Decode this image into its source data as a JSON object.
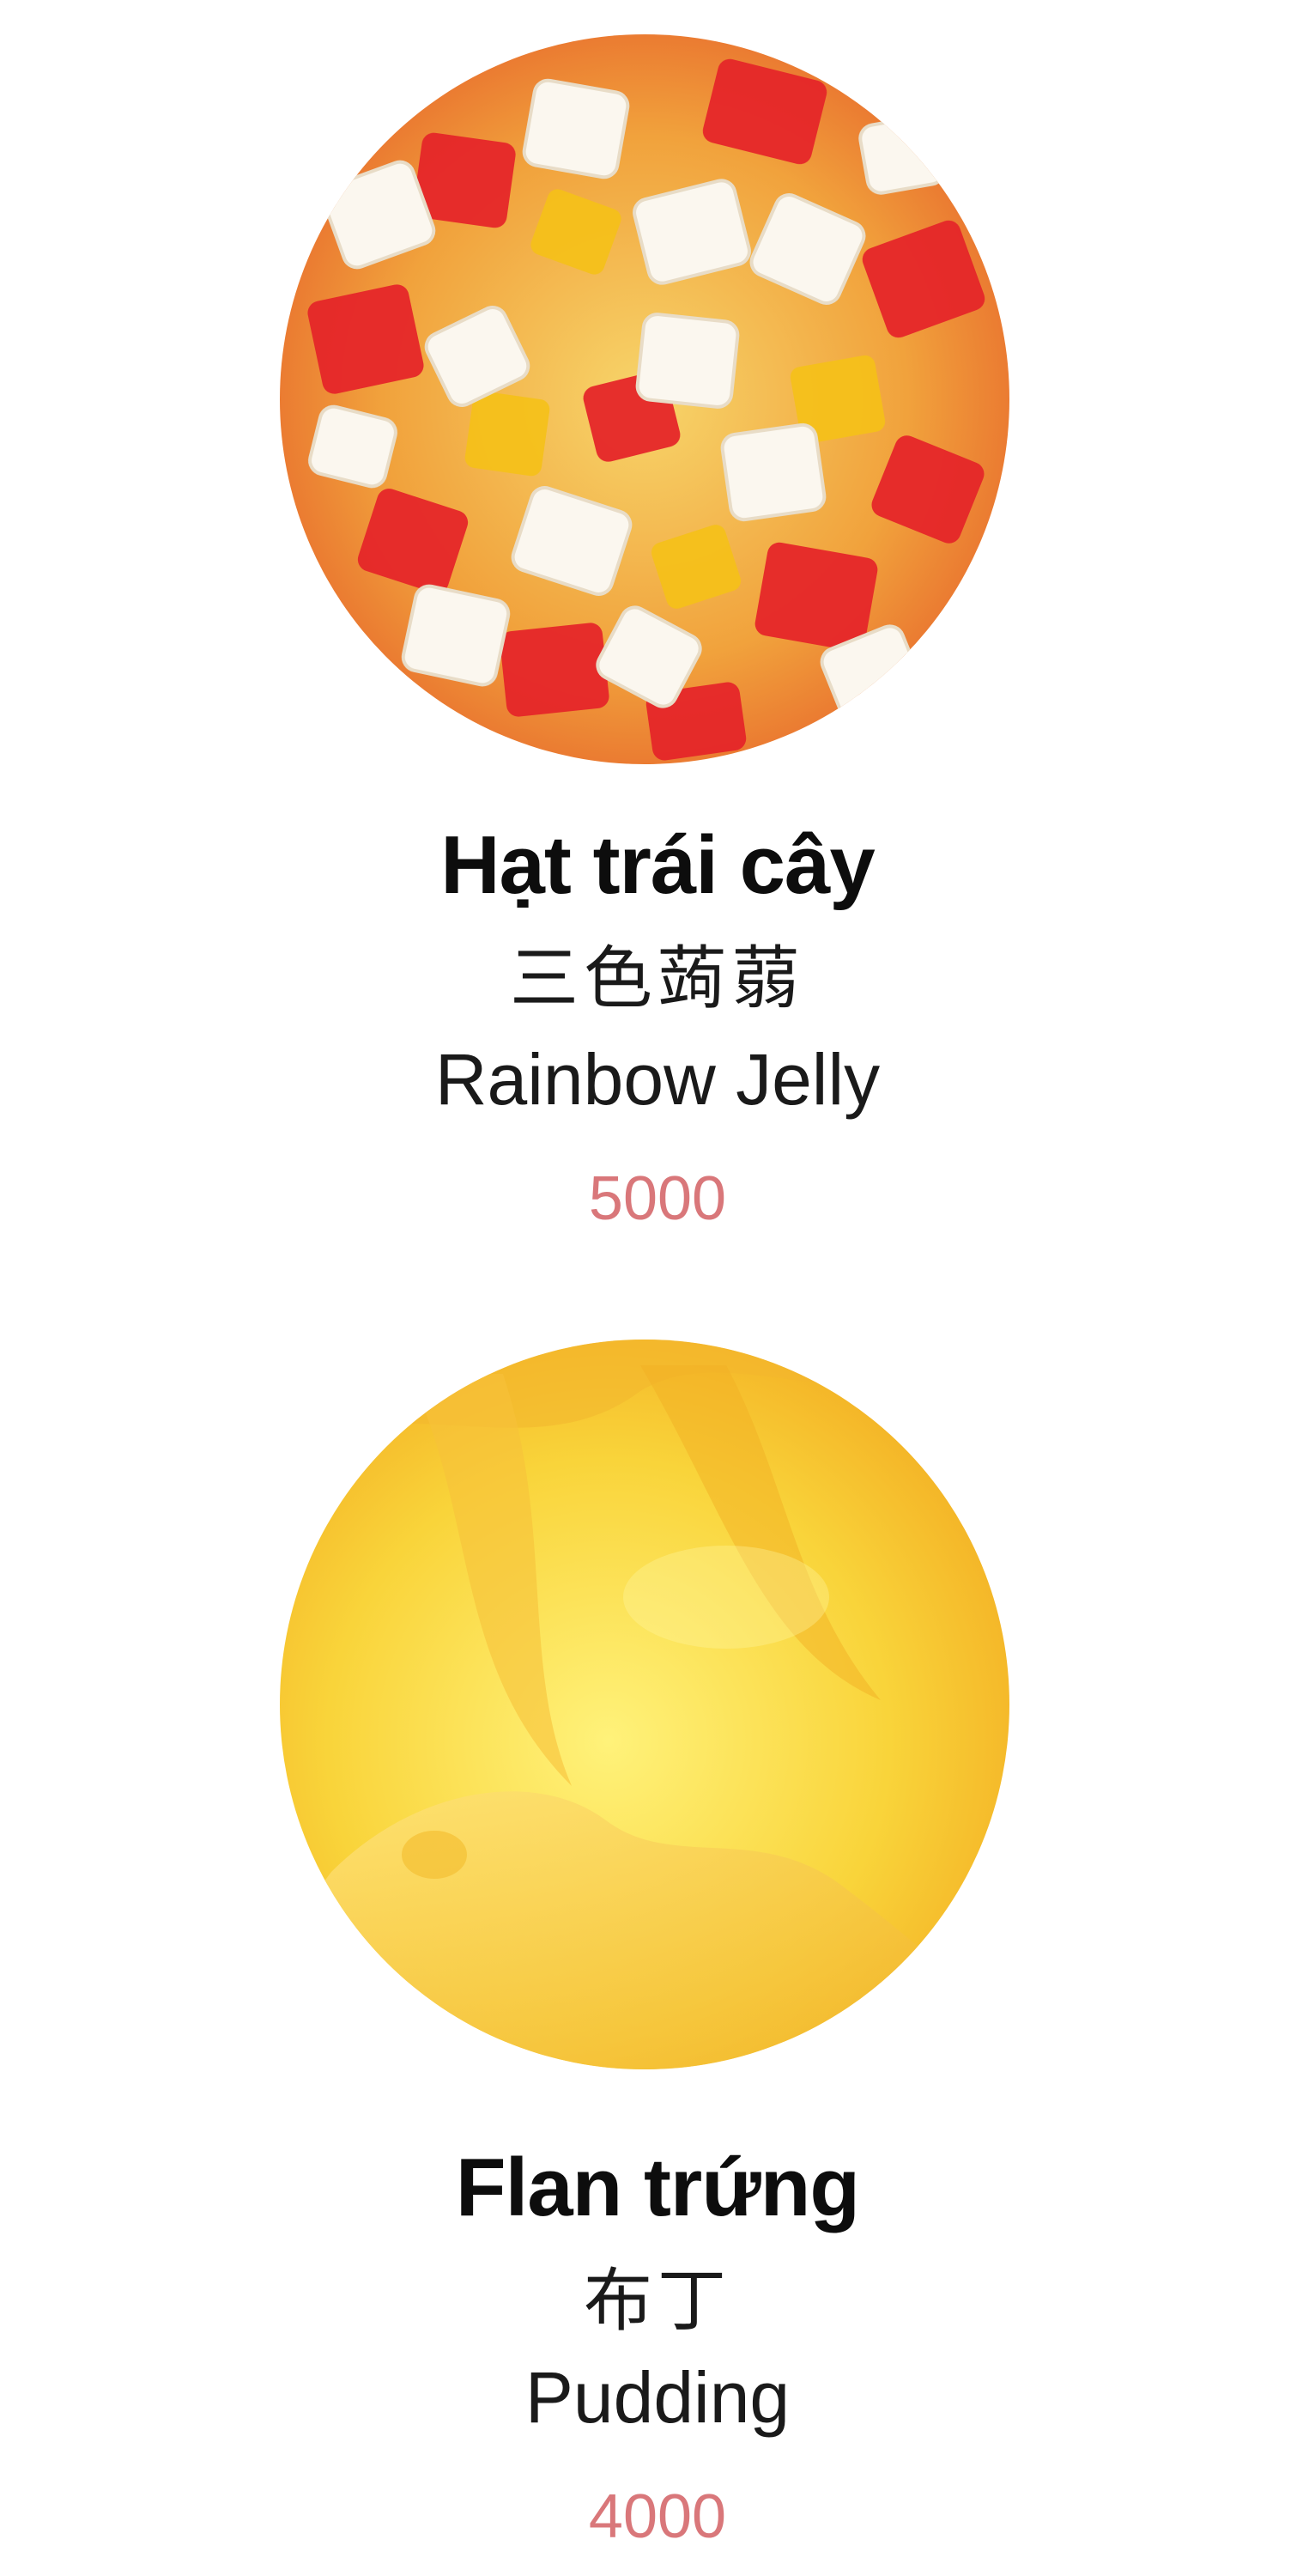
{
  "items": [
    {
      "name_vi": "Hạt trái cây",
      "name_zh": "三色蒟蒻",
      "name_en": "Rainbow Jelly",
      "price": "5000"
    },
    {
      "name_vi": "Flan trứng",
      "name_zh": "布丁",
      "name_en": "Pudding",
      "price": "4000"
    }
  ],
  "colors": {
    "price": "#d9777a",
    "title": "#0d0d0d",
    "background": "#ffffff"
  }
}
